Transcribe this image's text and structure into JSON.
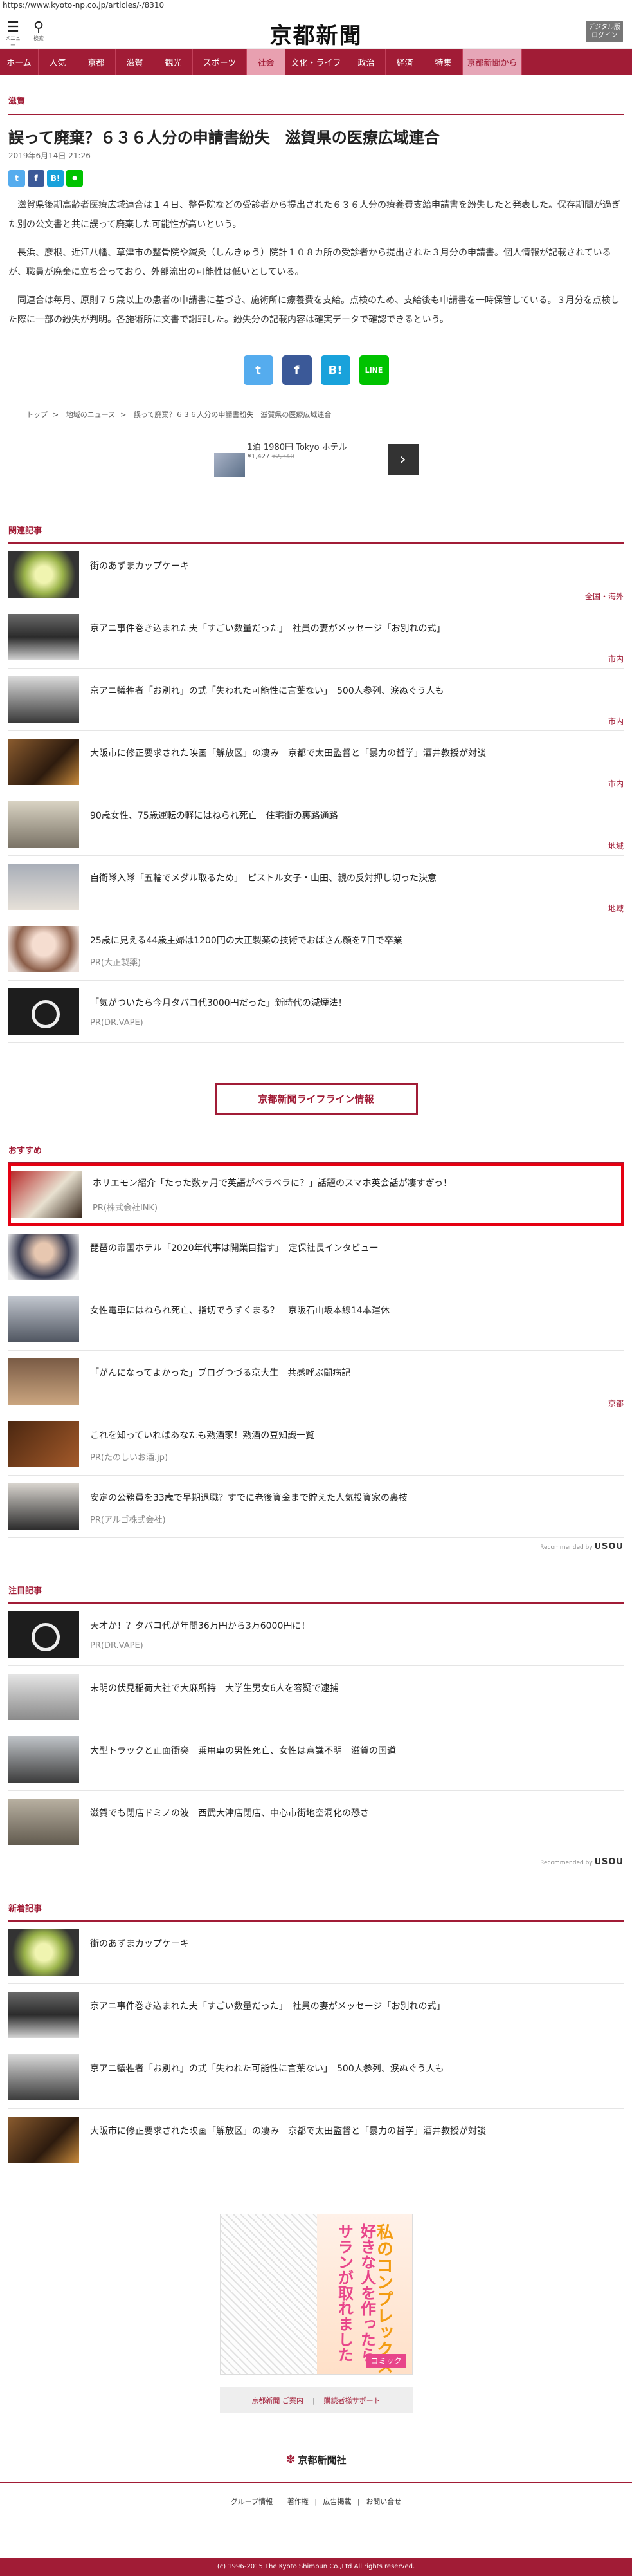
{
  "url": "https://www.kyoto-np.co.jp/articles/-/8310",
  "header": {
    "menu_caption": "メニュー",
    "search_caption": "検索",
    "logo": "京都新聞",
    "login_line1": "デジタル版",
    "login_line2": "ログイン"
  },
  "nav": [
    "ホーム",
    "人気",
    "京都",
    "滋賀",
    "観光",
    "スポーツ",
    "社会",
    "文化・ライフ",
    "政治",
    "経済",
    "特集",
    "京都新聞から"
  ],
  "article": {
    "category": "滋賀",
    "headline": "誤って廃棄？６３６人分の申請書紛失　滋賀県の医療広域連合",
    "date": "2019年6月14日 21:26",
    "paragraphs": [
      "滋賀県後期高齢者医療広域連合は１４日、整骨院などの受診者から提出された６３６人分の療養費支給申請書を紛失したと発表した。保存期間が過ぎた別の公文書と共に誤って廃棄した可能性が高いという。",
      "長浜、彦根、近江八幡、草津市の整骨院や鍼灸（しんきゅう）院計１０８カ所の受診者から提出された３月分の申請書。個人情報が記載されているが、職員が廃棄に立ち会っており、外部流出の可能性は低いとしている。",
      "同連合は毎月、原則７５歳以上の患者の申請書に基づき、施術所に療養費を支給。点検のため、支給後も申請書を一時保管している。３月分を点検した際に一部の紛失が判明。各施術所に文書で謝罪した。紛失分の記載内容は確実データで確認できるという。"
    ],
    "breadcrumb": [
      "トップ",
      "地域のニュース",
      "誤って廃棄？６３６人分の申請書紛失　滋賀県の医療広域連合"
    ]
  },
  "share": {
    "twitter": "t",
    "facebook": "f",
    "hatena": "B!",
    "line": "LINE"
  },
  "ad": {
    "text": "1泊 1980円 Tokyo ホテル",
    "price_now": "¥1,427",
    "price_old": "¥2,340"
  },
  "related": {
    "title": "関連記事",
    "items": [
      {
        "title": "街のあずまカップケーキ",
        "cat": "全国・海外"
      },
      {
        "title": "京アニ事件巻き込まれた夫「すごい数量だった」　社員の妻がメッセージ「お別れの式」",
        "cat": "市内"
      },
      {
        "title": "京アニ犠牲者「お別れ」の式「失われた可能性に言葉ない」　500人参列、涙ぬぐう人も",
        "cat": "市内"
      },
      {
        "title": "大阪市に修正要求された映画「解放区」の凄み　京都で太田監督と「暴力の哲学」酒井教授が対談",
        "cat": "市内"
      },
      {
        "title": "90歳女性、75歳運転の軽にはねられ死亡　住宅街の裏路通路",
        "cat": "地域"
      },
      {
        "title": "自衛隊入隊「五輪でメダル取るため」　ピストル女子・山田、親の反対押し切った決意",
        "cat": "地域"
      },
      {
        "title": "25歳に見える44歳主婦は1200円の大正製薬の技術でおばさん顔を7日で卒業",
        "sub": "PR(大正製薬)"
      },
      {
        "title": "「気がついたら今月タバコ代3000円だった」新時代の減煙法！",
        "sub": "PR(DR.VAPE)"
      }
    ]
  },
  "lifeline": "京都新聞ライフライン情報",
  "recommend": {
    "title": "おすすめ",
    "items": [
      {
        "title": "ホリエモン紹介「たった数ヶ月で英語がペラペラに？」話題のスマホ英会話が凄すぎっ！",
        "sub": "PR(株式会社INK)"
      },
      {
        "title": "琵琶の帝国ホテル「2020年代事は開業目指す」　定保社長インタビュー",
        "cat": ""
      },
      {
        "title": "女性電車にはねられ死亡、指切でうずくまる？　京阪石山坂本線14本運休",
        "cat": ""
      },
      {
        "title": "「がんになってよかった」ブログつづる京大生　共感呼ぶ闘病記",
        "cat": "京都"
      },
      {
        "title": "これを知っていればあなたも熟酒家！熟酒の豆知識一覧",
        "sub": "PR(たのしいお酒.jp)"
      },
      {
        "title": "安定の公務員を33歳で早期退職？すでに老後資金まで貯えた人気投資家の裏技",
        "sub": "PR(アルゴ株式会社)"
      }
    ],
    "recommended_by": "Recommended by",
    "brand": "USOU"
  },
  "attention": {
    "title": "注目記事",
    "items": [
      {
        "title": "天才か！？タバコ代が年間36万円から3万6000円に！",
        "sub": "PR(DR.VAPE)"
      },
      {
        "title": "未明の伏見稲荷大社で大麻所持　大学生男女6人を容疑で逮捕"
      },
      {
        "title": "大型トラックと正面衝突　乗用車の男性死亡、女性は意識不明　滋賀の国道"
      },
      {
        "title": "滋賀でも閉店ドミノの波　西武大津店閉店、中心市街地空洞化の恐さ"
      }
    ],
    "recommended_by": "Recommended by",
    "brand": "USOU"
  },
  "latest": {
    "title": "新着記事",
    "items": [
      {
        "title": "街のあずまカップケーキ"
      },
      {
        "title": "京アニ事件巻き込まれた夫「すごい数量だった」　社員の妻がメッセージ「お別れの式」"
      },
      {
        "title": "京アニ犠牲者「お別れ」の式「失われた可能性に言葉ない」　500人参列、涙ぬぐう人も"
      },
      {
        "title": "大阪市に修正要求された映画「解放区」の凄み　京都で太田監督と「暴力の哲学」酒井教授が対談"
      }
    ]
  },
  "manga_ad": {
    "line_a": "好きな人を作ったらサランが取れました",
    "line_b": "私のコンプレックス",
    "tag": "コミック"
  },
  "footer": {
    "btn1": "京都新聞 ご案内",
    "btn2": "購読者様サポート",
    "logo": "京都新聞社",
    "links": [
      "グループ情報",
      "著作権",
      "広告掲載",
      "お問い合せ"
    ],
    "copyright": "(c) 1996-2015 The Kyoto Shimbun Co.,Ltd All rights reserved."
  }
}
